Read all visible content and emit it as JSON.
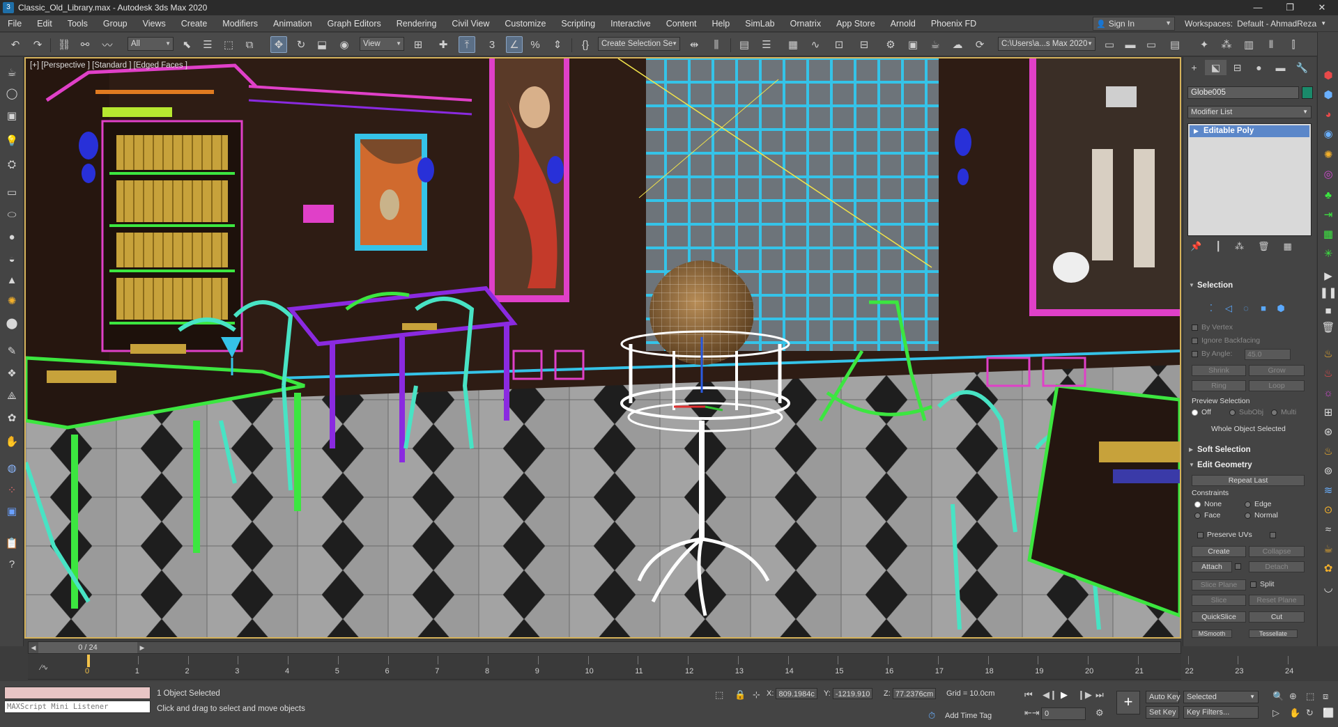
{
  "titlebar": {
    "title": "Classic_Old_Library.max - Autodesk 3ds Max 2020",
    "minimize": "—",
    "restore": "❐",
    "close": "✕"
  },
  "menu": [
    "File",
    "Edit",
    "Tools",
    "Group",
    "Views",
    "Create",
    "Modifiers",
    "Animation",
    "Graph Editors",
    "Rendering",
    "Civil View",
    "Customize",
    "Scripting",
    "Interactive",
    "Content",
    "Help",
    "SimLab",
    "Ornatrix",
    "App Store",
    "Arnold",
    "Phoenix FD"
  ],
  "account": {
    "sign_in": "Sign In",
    "workspaces_label": "Workspaces:",
    "workspace_value": "Default - AhmadReza"
  },
  "toolbar": {
    "filter_value": "All",
    "refcoord_value": "View",
    "selection_set": "Create Selection Se",
    "project_path": "C:\\Users\\a...s Max 2020",
    "snap_label": "3"
  },
  "viewport": {
    "label": "[+] [Perspective ] [Standard ] [Edged Faces ]"
  },
  "command_panel": {
    "object_name": "Globe005",
    "object_color": "#1a8a6a",
    "modifier_list": "Modifier List",
    "stack_item": "Editable Poly",
    "selection": {
      "title": "Selection",
      "by_vertex": "By Vertex",
      "ignore_backfacing": "Ignore Backfacing",
      "by_angle": "By Angle:",
      "angle_value": "45.0",
      "shrink": "Shrink",
      "grow": "Grow",
      "ring": "Ring",
      "loop": "Loop",
      "preview_selection": "Preview Selection",
      "off": "Off",
      "subobj": "SubObj",
      "multi": "Multi",
      "whole_object": "Whole Object Selected"
    },
    "soft_selection": "Soft Selection",
    "edit_geometry": {
      "title": "Edit Geometry",
      "repeat_last": "Repeat Last",
      "constraints": "Constraints",
      "none": "None",
      "edge": "Edge",
      "face": "Face",
      "normal": "Normal",
      "preserve_uvs": "Preserve UVs",
      "create": "Create",
      "collapse": "Collapse",
      "attach": "Attach",
      "detach": "Detach",
      "slice_plane": "Slice Plane",
      "split": "Split",
      "slice": "Slice",
      "reset_plane": "Reset Plane",
      "quickslice": "QuickSlice",
      "cut": "Cut",
      "msmooth": "MSmooth",
      "tessellate": "Tessellate"
    }
  },
  "timeline": {
    "frame_display": "0 / 24",
    "ticks": [
      "0",
      "1",
      "2",
      "3",
      "4",
      "5",
      "6",
      "7",
      "8",
      "9",
      "10",
      "11",
      "12",
      "13",
      "14",
      "15",
      "16",
      "17",
      "18",
      "19",
      "20",
      "21",
      "22",
      "23",
      "24"
    ]
  },
  "status": {
    "maxscript": "MAXScript Mini Listener",
    "selected": "1 Object Selected",
    "prompt": "Click and drag to select and move objects",
    "x_label": "X:",
    "x_value": "809.1984c",
    "y_label": "Y:",
    "y_value": "-1219.910",
    "z_label": "Z:",
    "z_value": "77.2376cm",
    "grid": "Grid = 10.0cm",
    "add_time_tag": "Add Time Tag",
    "auto_key": "Auto Key",
    "selected_mode": "Selected",
    "set_key": "Set Key",
    "key_filters": "Key Filters...",
    "frame_value": "0"
  }
}
